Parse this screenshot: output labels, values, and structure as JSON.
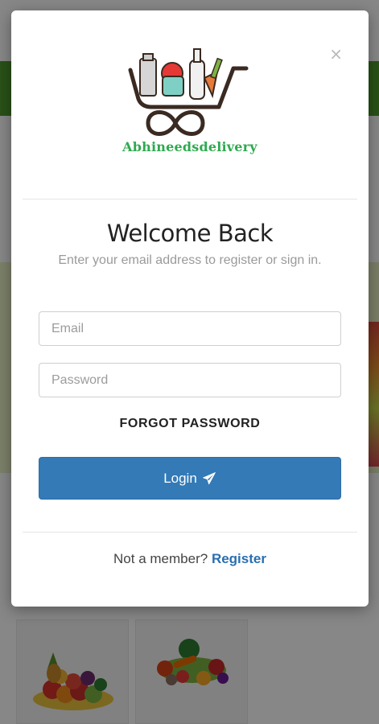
{
  "colors": {
    "accent_button": "#337ab7",
    "brand_green": "#2eaa4e",
    "register_link": "#2a6fb0",
    "background_bar_green": "#4f9a2c"
  },
  "modal": {
    "close_symbol": "×",
    "brand_name": "Abhineedsdelivery",
    "title": "Welcome Back",
    "subtitle": "Enter your email address to register or sign in.",
    "email": {
      "value": "",
      "placeholder": "Email"
    },
    "password": {
      "value": "",
      "placeholder": "Password"
    },
    "forgot_label": "FORGOT PASSWORD",
    "login_label": "Login",
    "login_icon": "paper-plane-icon",
    "footer_text": "Not a member?",
    "register_label": "Register"
  }
}
